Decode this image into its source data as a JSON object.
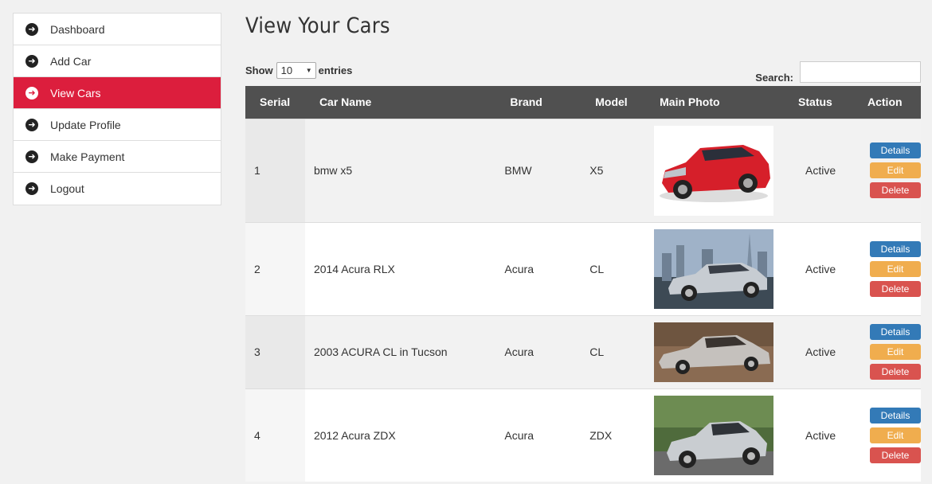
{
  "sidebar": {
    "items": [
      {
        "label": "Dashboard",
        "icon": "arrow-right-circle-icon",
        "active": false
      },
      {
        "label": "Add Car",
        "icon": "arrow-right-circle-icon",
        "active": false
      },
      {
        "label": "View Cars",
        "icon": "arrow-right-circle-icon",
        "active": true
      },
      {
        "label": "Update Profile",
        "icon": "arrow-right-circle-icon",
        "active": false
      },
      {
        "label": "Make Payment",
        "icon": "arrow-right-circle-icon",
        "active": false
      },
      {
        "label": "Logout",
        "icon": "arrow-right-circle-icon",
        "active": false
      }
    ],
    "active_color": "#dc1e3d"
  },
  "page": {
    "title": "View Your Cars"
  },
  "controls": {
    "show_label": "Show",
    "entries_value": "10",
    "entries_label": "entries",
    "search_label": "Search:",
    "search_value": ""
  },
  "table": {
    "headers": [
      "Serial",
      "Car Name",
      "Brand",
      "Model",
      "Main Photo",
      "Status",
      "Action"
    ],
    "rows": [
      {
        "serial": "1",
        "name": "bmw x5",
        "brand": "BMW",
        "model": "X5",
        "status": "Active",
        "photo": "red-sedan"
      },
      {
        "serial": "2",
        "name": "2014 Acura RLX",
        "brand": "Acura",
        "model": "CL",
        "status": "Active",
        "photo": "silver-sedan-city"
      },
      {
        "serial": "3",
        "name": "2003 ACURA CL in Tucson",
        "brand": "Acura",
        "model": "CL",
        "status": "Active",
        "photo": "silver-coupe"
      },
      {
        "serial": "4",
        "name": "2012 Acura ZDX",
        "brand": "Acura",
        "model": "ZDX",
        "status": "Active",
        "photo": "silver-crossover"
      }
    ],
    "action_labels": {
      "details": "Details",
      "edit": "Edit",
      "delete": "Delete"
    }
  },
  "colors": {
    "header_bg": "#505050",
    "details": "#337ab7",
    "edit": "#f0ad4e",
    "delete": "#d9534f"
  }
}
